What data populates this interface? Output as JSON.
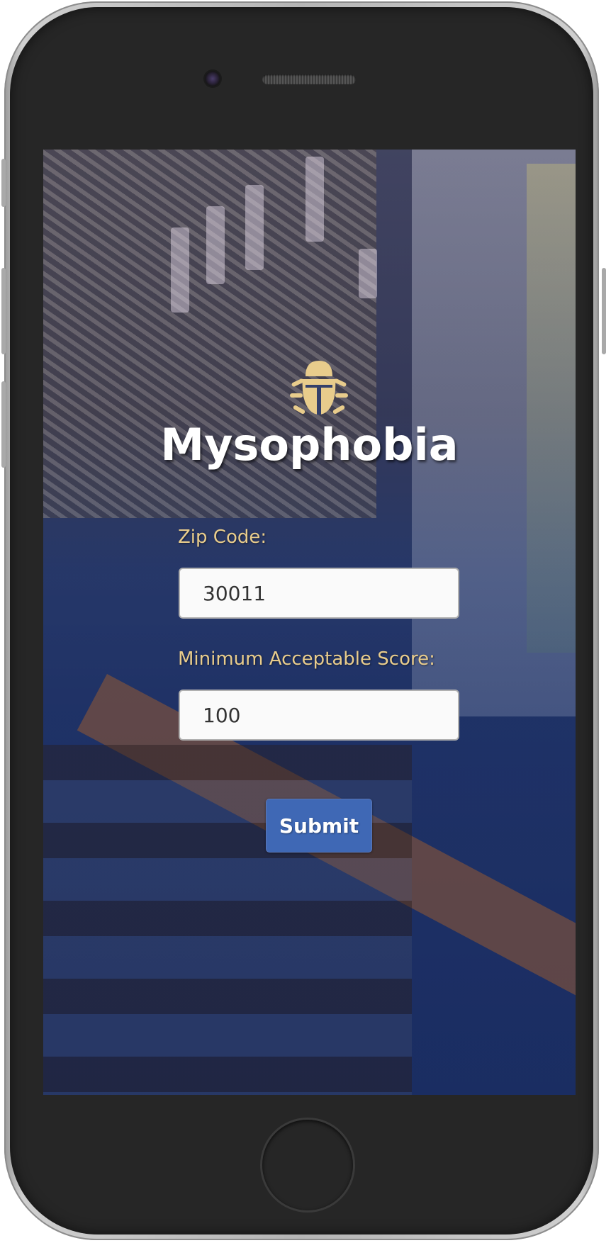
{
  "app": {
    "title": "Mysophobia",
    "logo_icon": "bug-icon",
    "accent_color": "#e8cc8c",
    "button_color": "#3f68b5"
  },
  "form": {
    "zip_label": "Zip Code:",
    "zip_value": "30011",
    "score_label": "Minimum Acceptable Score:",
    "score_value": "100",
    "submit_label": "Submit"
  }
}
